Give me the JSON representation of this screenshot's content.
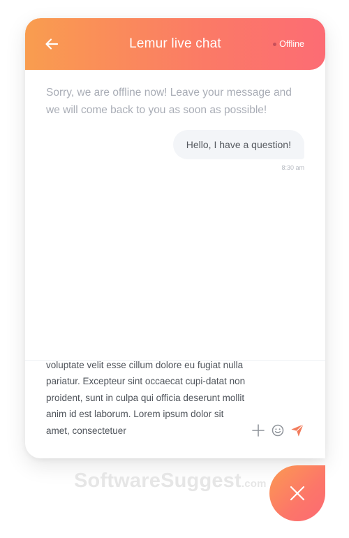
{
  "header": {
    "title": "Lemur live chat",
    "status": "Offline"
  },
  "messages": {
    "offline_notice": "Sorry, we are offline now! Leave your message and we will come back to you as soon as possible!",
    "user_bubble": "Hello, I have a question!",
    "user_time": "8:30 am"
  },
  "compose": {
    "text": "voluptate velit esse cillum dolore eu fugiat nulla pariatur. Excepteur sint occaecat cupi-datat non proident, sunt in culpa qui officia deserunt mollit anim id est laborum. Lorem ipsum dolor sit amet, consectetuer"
  },
  "watermark": {
    "brand": "SoftwareSuggest",
    "suffix": ".com"
  },
  "icons": {
    "back": "arrow-left-icon",
    "attach": "plus-icon",
    "emoji": "smiley-icon",
    "send": "paper-plane-icon",
    "close": "close-icon"
  },
  "colors": {
    "header_gradient_start": "#f99d4f",
    "header_gradient_end": "#fc6c74",
    "send_accent": "#f27c5c"
  }
}
